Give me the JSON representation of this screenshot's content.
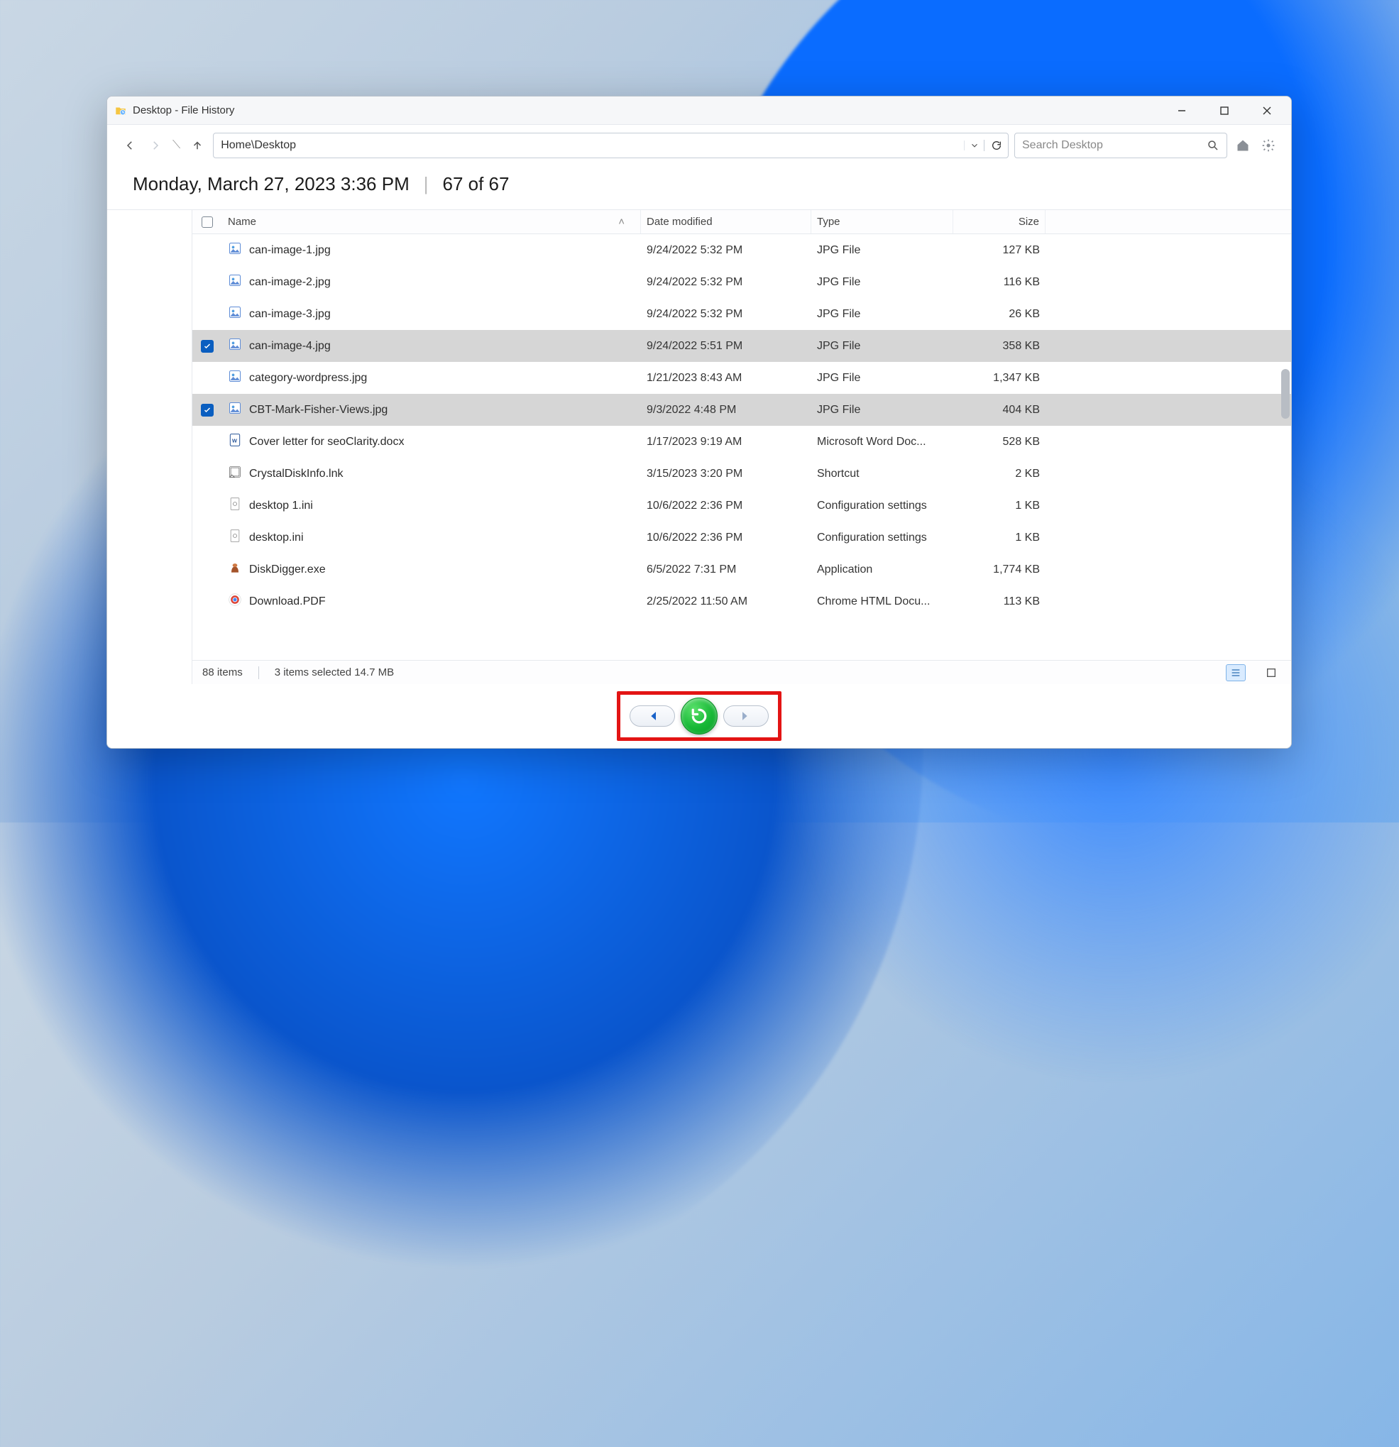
{
  "window": {
    "title": "Desktop - File History"
  },
  "toolbar": {
    "path": "Home\\Desktop",
    "search_placeholder": "Search Desktop"
  },
  "snapshot": {
    "timestamp": "Monday, March 27, 2023 3:36 PM",
    "position": "67 of 67"
  },
  "columns": {
    "name": "Name",
    "date": "Date modified",
    "type": "Type",
    "size": "Size"
  },
  "files": [
    {
      "name": "can-image-1.jpg",
      "date": "9/24/2022 5:32 PM",
      "type": "JPG File",
      "size": "127 KB",
      "icon": "jpg",
      "selected": false
    },
    {
      "name": "can-image-2.jpg",
      "date": "9/24/2022 5:32 PM",
      "type": "JPG File",
      "size": "116 KB",
      "icon": "jpg",
      "selected": false
    },
    {
      "name": "can-image-3.jpg",
      "date": "9/24/2022 5:32 PM",
      "type": "JPG File",
      "size": "26 KB",
      "icon": "jpg",
      "selected": false
    },
    {
      "name": "can-image-4.jpg",
      "date": "9/24/2022 5:51 PM",
      "type": "JPG File",
      "size": "358 KB",
      "icon": "jpg",
      "selected": true
    },
    {
      "name": "category-wordpress.jpg",
      "date": "1/21/2023 8:43 AM",
      "type": "JPG File",
      "size": "1,347 KB",
      "icon": "jpg",
      "selected": false
    },
    {
      "name": "CBT-Mark-Fisher-Views.jpg",
      "date": "9/3/2022 4:48 PM",
      "type": "JPG File",
      "size": "404 KB",
      "icon": "jpg",
      "selected": true
    },
    {
      "name": "Cover letter for seoClarity.docx",
      "date": "1/17/2023 9:19 AM",
      "type": "Microsoft Word Doc...",
      "size": "528 KB",
      "icon": "docx",
      "selected": false
    },
    {
      "name": "CrystalDiskInfo.lnk",
      "date": "3/15/2023 3:20 PM",
      "type": "Shortcut",
      "size": "2 KB",
      "icon": "lnk",
      "selected": false
    },
    {
      "name": "desktop 1.ini",
      "date": "10/6/2022 2:36 PM",
      "type": "Configuration settings",
      "size": "1 KB",
      "icon": "ini",
      "selected": false
    },
    {
      "name": "desktop.ini",
      "date": "10/6/2022 2:36 PM",
      "type": "Configuration settings",
      "size": "1 KB",
      "icon": "ini",
      "selected": false
    },
    {
      "name": "DiskDigger.exe",
      "date": "6/5/2022 7:31 PM",
      "type": "Application",
      "size": "1,774 KB",
      "icon": "exe",
      "selected": false
    },
    {
      "name": "Download.PDF",
      "date": "2/25/2022 11:50 AM",
      "type": "Chrome HTML Docu...",
      "size": "113 KB",
      "icon": "pdf",
      "selected": false
    }
  ],
  "status": {
    "total": "88 items",
    "selection": "3 items selected  14.7 MB"
  }
}
